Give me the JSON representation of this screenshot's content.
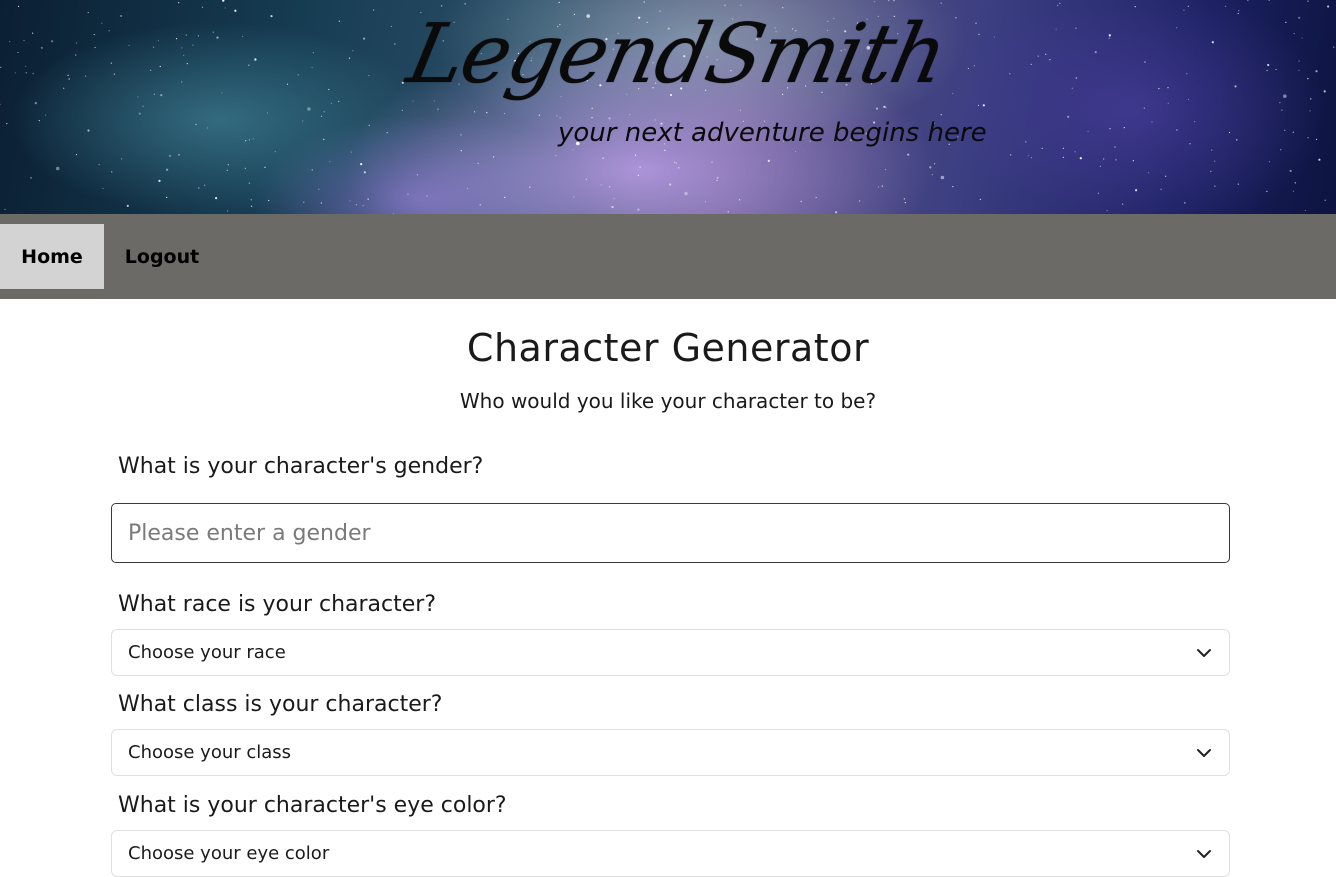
{
  "header": {
    "logo_text": "LegendSmith",
    "tagline": "your next adventure begins here"
  },
  "nav": {
    "items": [
      {
        "label": "Home",
        "active": true
      },
      {
        "label": "Logout",
        "active": false
      }
    ],
    "bar_color": "#6c6a66",
    "active_color": "#d3d3d3"
  },
  "main": {
    "title": "Character Generator",
    "subtitle": "Who would you like your character to be?",
    "gender": {
      "question": "What is your character's gender?",
      "placeholder": "Please enter a gender",
      "value": ""
    },
    "race": {
      "question": "What race is your character?",
      "selected": "Choose your race"
    },
    "class": {
      "question": "What class is your character?",
      "selected": "Choose your class"
    },
    "eye_color": {
      "question": "What is your character's eye color?",
      "selected": "Choose your eye color"
    }
  },
  "icons": {
    "dropdown": "chevron-down-icon"
  }
}
